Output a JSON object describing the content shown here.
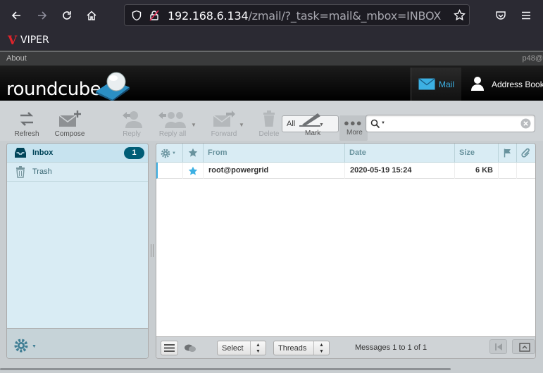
{
  "browser": {
    "url_host": "192.168.6.134",
    "url_path": "/zmail/?_task=mail&_mbox=INBOX",
    "bookmark_label": "VIPER",
    "bookmark_mark": "V"
  },
  "topline": {
    "about_label": "About",
    "user_short": "p48@"
  },
  "header": {
    "logo_text": "roundcube",
    "tasks": [
      {
        "label": "Mail",
        "icon": "envelope-icon",
        "active": true
      },
      {
        "label": "Address Book",
        "icon": "person-icon",
        "active": false
      }
    ]
  },
  "toolbar": {
    "refresh": "Refresh",
    "compose": "Compose",
    "reply": "Reply",
    "reply_all": "Reply all",
    "forward": "Forward",
    "delete": "Delete",
    "mark": "Mark",
    "mark_filter": "All",
    "more": "More",
    "search_placeholder": ""
  },
  "folders": [
    {
      "name": "Inbox",
      "unread": "1",
      "icon": "inbox-icon"
    },
    {
      "name": "Trash",
      "unread": "",
      "icon": "trash-icon"
    }
  ],
  "messages": {
    "columns": {
      "from": "From",
      "date": "Date",
      "size": "Size"
    },
    "rows": [
      {
        "from": "root@powergrid",
        "date": "2020-05-19 15:24",
        "size": "6 KB",
        "flagged": true
      }
    ]
  },
  "list_footer": {
    "select_label": "Select",
    "threads_label": "Threads",
    "count_text": "Messages 1 to 1 of 1"
  },
  "colors": {
    "accent": "#3cb0e3",
    "badge": "#005d76",
    "folder_bg": "#d9ecf4"
  }
}
